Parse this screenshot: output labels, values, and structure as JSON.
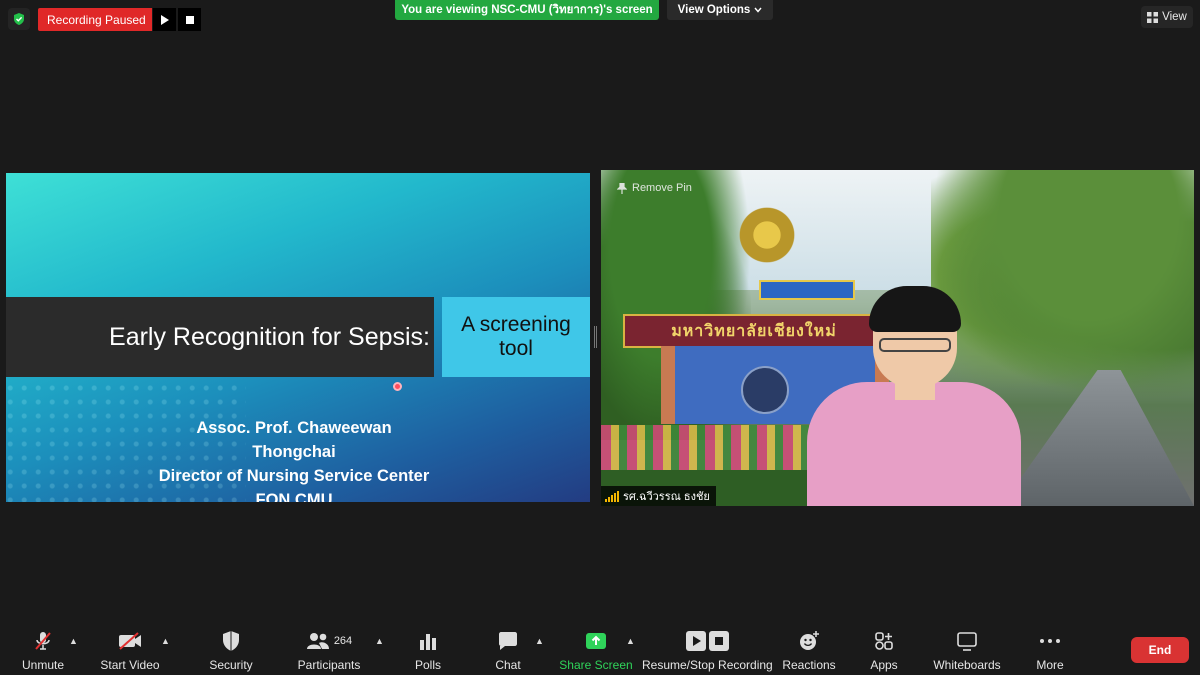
{
  "top_bar": {
    "recording_status": "Recording Paused",
    "viewing_banner": "You are viewing NSC-CMU (วิทยาการ)'s screen",
    "view_options": "View Options",
    "view_label": "View"
  },
  "slide": {
    "title": "Early Recognition for Sepsis:",
    "subtitle_line1": "A screening",
    "subtitle_line2": "tool",
    "presenter_line1": "Assoc. Prof. Chaweewan Thongchai",
    "presenter_line2": "Director of Nursing Service Center",
    "presenter_line3": "FON CMU"
  },
  "video": {
    "remove_pin": "Remove Pin",
    "participant_name": "รศ.ฉวีวรรณ  ธงชัย",
    "campus_sign": "มหาวิทยาลัยเชียงใหม่"
  },
  "toolbar": {
    "unmute": "Unmute",
    "start_video": "Start Video",
    "security": "Security",
    "participants": "Participants",
    "participants_count": "264",
    "polls": "Polls",
    "chat": "Chat",
    "share_screen": "Share Screen",
    "resume_stop_recording": "Resume/Stop Recording",
    "reactions": "Reactions",
    "apps": "Apps",
    "whiteboards": "Whiteboards",
    "more": "More",
    "end": "End"
  },
  "colors": {
    "recording_red": "#e02828",
    "banner_green": "#23a840",
    "share_green": "#2fd35a",
    "end_red": "#d93333"
  }
}
